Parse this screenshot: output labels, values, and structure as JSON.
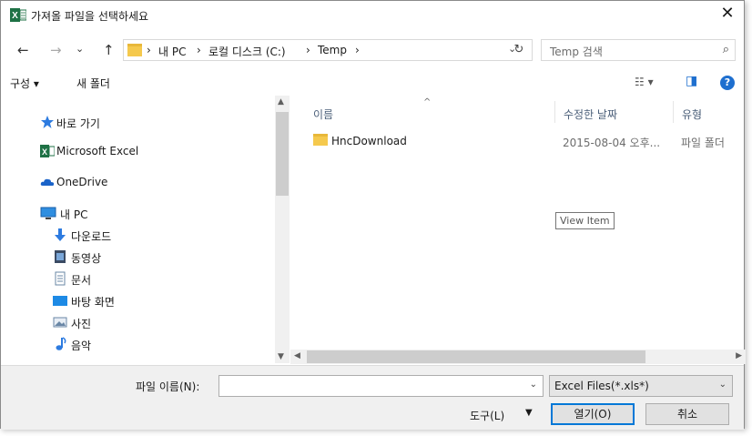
{
  "window": {
    "title": "가져올 파일을 선택하세요",
    "close_glyph": "✕"
  },
  "nav": {
    "back": "←",
    "forward": "→",
    "recent": "⌄",
    "up": "↑"
  },
  "address": {
    "sep1": "›",
    "crumb1": "내 PC",
    "sep2": "›",
    "crumb2": "로컬 디스크 (C:)",
    "sep3": "›",
    "crumb3": "Temp",
    "sep4": "›",
    "dropdown_glyph": "⌄",
    "refresh_glyph": "↻"
  },
  "search": {
    "placeholder": "Temp 검색",
    "icon_glyph": "⌕"
  },
  "toolbar": {
    "organize": "구성 ▾",
    "new_folder": "새 폴더",
    "view_glyph": "☷ ▾",
    "preview_glyph": "◨",
    "help_glyph": "?"
  },
  "sidebar": {
    "items": [
      {
        "label": "바로 가기",
        "icon": "star-icon"
      },
      {
        "label": "Microsoft Excel",
        "icon": "excel-icon"
      },
      {
        "label": "OneDrive",
        "icon": "cloud-icon"
      },
      {
        "label": "내 PC",
        "icon": "pc-icon"
      },
      {
        "label": "다운로드",
        "icon": "download-icon"
      },
      {
        "label": "동영상",
        "icon": "video-icon"
      },
      {
        "label": "문서",
        "icon": "document-icon"
      },
      {
        "label": "바탕 화면",
        "icon": "desktop-icon"
      },
      {
        "label": "사진",
        "icon": "picture-icon"
      },
      {
        "label": "음악",
        "icon": "music-icon"
      }
    ]
  },
  "columns": {
    "name": "이름",
    "date": "수정한 날짜",
    "type": "유형"
  },
  "files": [
    {
      "name": "HncDownload",
      "date": "2015-08-04 오후...",
      "type": "파일 폴더"
    }
  ],
  "tooltip": "View Item",
  "footer": {
    "filename_label": "파일 이름(N):",
    "filename_value": "",
    "filter_value": "Excel Files(*.xls*)",
    "tools_label": "도구(L)",
    "open_label": "열기(O)",
    "cancel_label": "취소"
  },
  "colors": {
    "accent": "#0078d7",
    "excel_green": "#1e7145",
    "folder_yellow": "#f5c94d"
  }
}
